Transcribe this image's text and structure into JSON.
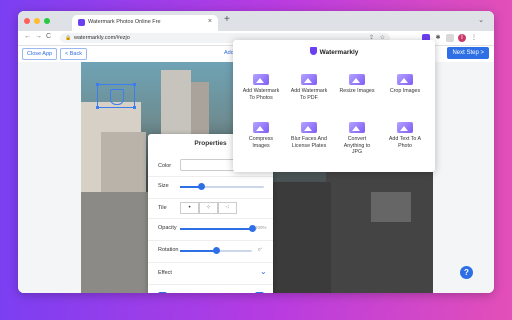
{
  "browser": {
    "tab_title": "Watermark Photos Online Fre",
    "tab_close": "×",
    "new_tab": "+",
    "tab_menu": "⌄",
    "url": "watermarkly.com/#ezjo",
    "back": "←",
    "forward": "→",
    "reload": "C",
    "lock": "🔒",
    "profile_initial": "I"
  },
  "appbar": {
    "close_app": "Close App",
    "back": "< Back",
    "add": "Add",
    "next_step": "Next Step >"
  },
  "properties": {
    "title": "Properties",
    "color_label": "Color",
    "size_label": "Size",
    "size_value": 0.25,
    "tile_label": "Tile",
    "opacity_label": "Opacity",
    "opacity_value_text": "100%",
    "opacity_value": 1.0,
    "rotation_label": "Rotation",
    "rotation_value_text": "0°",
    "rotation_value": 0.5,
    "effect_label": "Effect",
    "effect_chevron": "⌄"
  },
  "menu": {
    "title": "Watermarkly",
    "tools": [
      {
        "label1": "Add Watermark",
        "label2": "To Photos"
      },
      {
        "label1": "Add Watermark",
        "label2": "To PDF"
      },
      {
        "label1": "Resize Images",
        "label2": ""
      },
      {
        "label1": "Crop Images",
        "label2": ""
      },
      {
        "label1": "Compress",
        "label2": "Images"
      },
      {
        "label1": "Blur Faces And",
        "label2": "License Plates"
      },
      {
        "label1": "Convert",
        "label2": "Anything to",
        "label3": "JPG"
      },
      {
        "label1": "Add Text To A",
        "label2": "Photo"
      }
    ]
  },
  "help": "?",
  "colors": {
    "accent": "#2f6fe6",
    "brand": "#6b3ff2"
  }
}
